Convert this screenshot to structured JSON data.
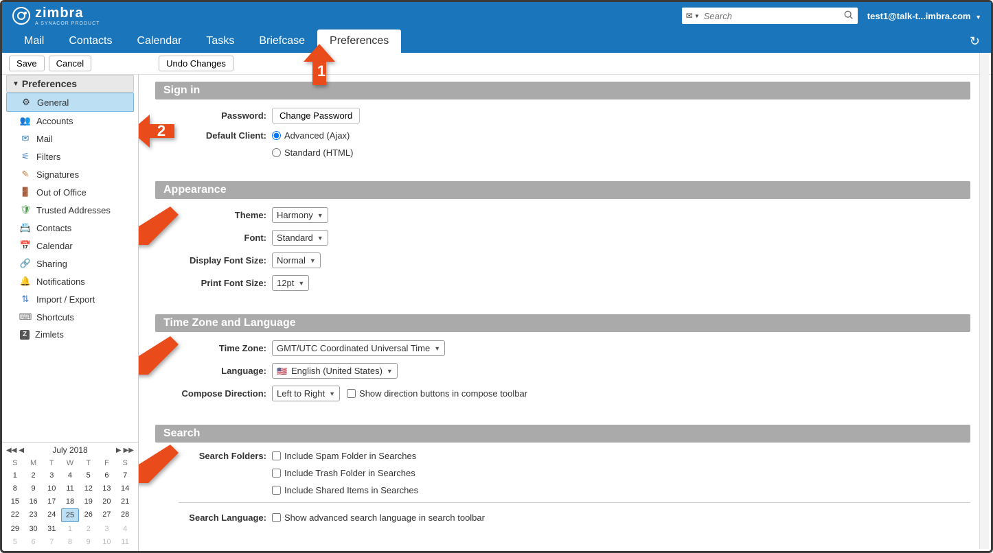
{
  "header": {
    "logo_main": "zimbra",
    "logo_sub": "A SYNACOR PRODUCT",
    "search_placeholder": "Search",
    "user": "test1@talk-t...imbra.com"
  },
  "tabs": [
    {
      "label": "Mail"
    },
    {
      "label": "Contacts"
    },
    {
      "label": "Calendar"
    },
    {
      "label": "Tasks"
    },
    {
      "label": "Briefcase"
    },
    {
      "label": "Preferences",
      "active": true
    }
  ],
  "toolbar": {
    "save": "Save",
    "cancel": "Cancel",
    "undo": "Undo Changes"
  },
  "sidebar": {
    "title": "Preferences",
    "items": [
      {
        "label": "General",
        "icon": "gear",
        "active": true
      },
      {
        "label": "Accounts",
        "icon": "accounts"
      },
      {
        "label": "Mail",
        "icon": "mail"
      },
      {
        "label": "Filters",
        "icon": "filters"
      },
      {
        "label": "Signatures",
        "icon": "signatures"
      },
      {
        "label": "Out of Office",
        "icon": "ooo"
      },
      {
        "label": "Trusted Addresses",
        "icon": "shield"
      },
      {
        "label": "Contacts",
        "icon": "contacts"
      },
      {
        "label": "Calendar",
        "icon": "calendar"
      },
      {
        "label": "Sharing",
        "icon": "sharing"
      },
      {
        "label": "Notifications",
        "icon": "bell"
      },
      {
        "label": "Import / Export",
        "icon": "import"
      },
      {
        "label": "Shortcuts",
        "icon": "shortcuts"
      },
      {
        "label": "Zimlets",
        "icon": "zimlets"
      }
    ]
  },
  "calendar": {
    "title": "July 2018",
    "dow": [
      "S",
      "M",
      "T",
      "W",
      "T",
      "F",
      "S"
    ],
    "today": 25,
    "days": [
      [
        1,
        2,
        3,
        4,
        5,
        6,
        7
      ],
      [
        8,
        9,
        10,
        11,
        12,
        13,
        14
      ],
      [
        15,
        16,
        17,
        18,
        19,
        20,
        21
      ],
      [
        22,
        23,
        24,
        25,
        26,
        27,
        28
      ],
      [
        29,
        30,
        31,
        1,
        2,
        3,
        4
      ],
      [
        5,
        6,
        7,
        8,
        9,
        10,
        11
      ]
    ]
  },
  "sections": {
    "signin": {
      "title": "Sign in",
      "password_label": "Password:",
      "password_btn": "Change Password",
      "client_label": "Default Client:",
      "client_advanced": "Advanced (Ajax)",
      "client_standard": "Standard (HTML)"
    },
    "appearance": {
      "title": "Appearance",
      "theme_label": "Theme:",
      "theme_value": "Harmony",
      "font_label": "Font:",
      "font_value": "Standard",
      "dfs_label": "Display Font Size:",
      "dfs_value": "Normal",
      "pfs_label": "Print Font Size:",
      "pfs_value": "12pt"
    },
    "tz": {
      "title": "Time Zone and Language",
      "tz_label": "Time Zone:",
      "tz_value": "GMT/UTC Coordinated Universal Time",
      "lang_label": "Language:",
      "lang_value": "English (United States)",
      "cd_label": "Compose Direction:",
      "cd_value": "Left to Right",
      "cd_check": "Show direction buttons in compose toolbar"
    },
    "search": {
      "title": "Search",
      "sf_label": "Search Folders:",
      "spam": "Include Spam Folder in Searches",
      "trash": "Include Trash Folder in Searches",
      "shared": "Include Shared Items in Searches",
      "sl_label": "Search Language:",
      "sl_check": "Show advanced search language in search toolbar"
    }
  },
  "callouts": {
    "one": "1",
    "two": "2"
  }
}
